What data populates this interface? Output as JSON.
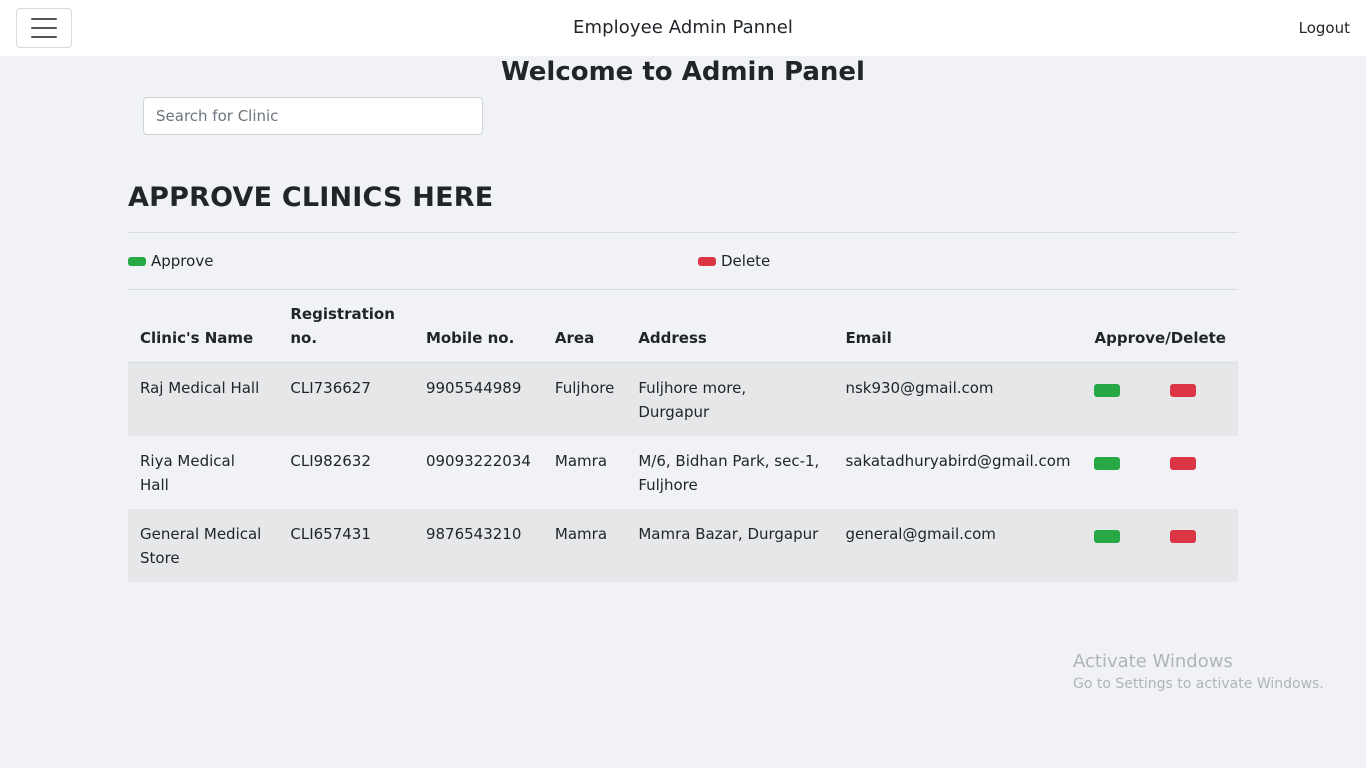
{
  "navbar": {
    "brand": "Employee Admin Pannel",
    "logout_label": "Logout",
    "menu_icon": "hamburger-menu-icon"
  },
  "page": {
    "welcome": "Welcome to Admin Panel",
    "search_placeholder": "Search for Clinic",
    "section_title": "APPROVE CLINICS HERE"
  },
  "legend": {
    "approve_label": "Approve",
    "delete_label": "Delete",
    "approve_color": "#28a745",
    "delete_color": "#dc3545"
  },
  "table": {
    "headers": [
      "Clinic's Name",
      "Registration no.",
      "Mobile no.",
      "Area",
      "Address",
      "Email",
      "Approve/Delete"
    ],
    "rows": [
      {
        "name": "Raj Medical Hall",
        "reg": "CLI736627",
        "mobile": "9905544989",
        "area": "Fuljhore",
        "address": "Fuljhore more, Durgapur",
        "email": "nsk930@gmail.com"
      },
      {
        "name": "Riya Medical Hall",
        "reg": "CLI982632",
        "mobile": "09093222034",
        "area": "Mamra",
        "address": "M/6, Bidhan Park, sec-1, Fuljhore",
        "email": "sakatadhuryabird@gmail.com"
      },
      {
        "name": "General Medical Store",
        "reg": "CLI657431",
        "mobile": "9876543210",
        "area": "Mamra",
        "address": "Mamra Bazar, Durgapur",
        "email": "general@gmail.com"
      }
    ]
  },
  "watermark": {
    "line1": "Activate Windows",
    "line2": "Go to Settings to activate Windows."
  }
}
